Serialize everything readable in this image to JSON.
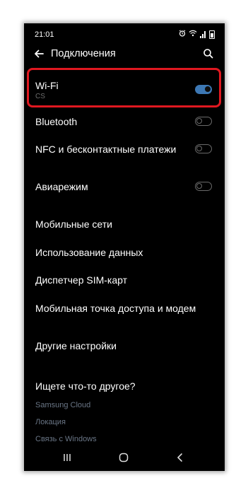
{
  "status_bar": {
    "time": "21:01",
    "icons": [
      "alarm-icon",
      "wifi-icon",
      "signal-icon",
      "battery-icon"
    ]
  },
  "header": {
    "title": "Подключения",
    "back_icon": "arrow-left-icon",
    "search_icon": "search-icon"
  },
  "wifi": {
    "label": "Wi-Fi",
    "network": "CS",
    "enabled": true
  },
  "toggles": [
    {
      "label": "Bluetooth",
      "enabled": false
    },
    {
      "label": "NFC и бесконтактные платежи",
      "enabled": false
    },
    {
      "label": "Авиарежим",
      "enabled": false
    }
  ],
  "menu": [
    "Мобильные сети",
    "Использование данных",
    "Диспетчер SIM-карт",
    "Мобильная точка доступа и модем",
    "Другие настройки"
  ],
  "suggestions": {
    "heading": "Ищете что-то другое?",
    "links": [
      "Samsung Cloud",
      "Локация",
      "Связь с Windows"
    ]
  },
  "nav_bar": [
    "recents-icon",
    "home-icon",
    "back-icon"
  ],
  "colors": {
    "accent": "#3d78b4",
    "highlight": "#e01820",
    "link": "#6a7686",
    "background": "#000000"
  }
}
